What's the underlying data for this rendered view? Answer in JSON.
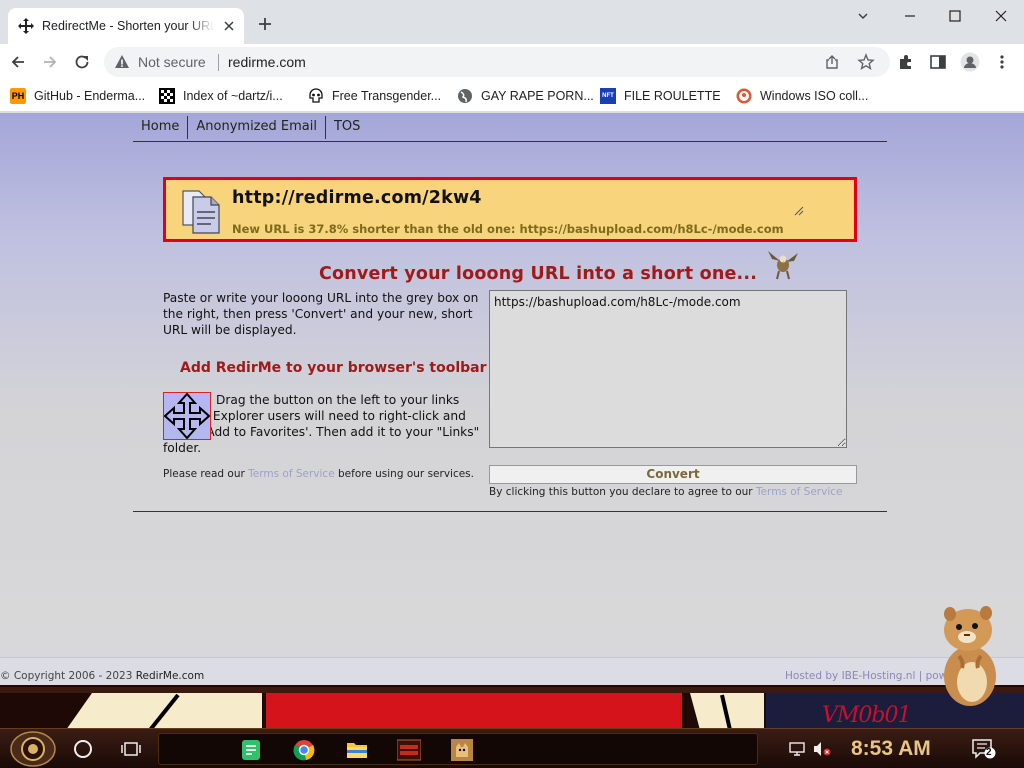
{
  "browser": {
    "tab_title": "RedirectMe - Shorten your URL",
    "security_label": "Not secure",
    "url": "redirme.com"
  },
  "bookmarks": [
    {
      "label": "GitHub - Enderma...",
      "icon": "ph-icon"
    },
    {
      "label": "Index of ~dartz/i...",
      "icon": "checker-icon"
    },
    {
      "label": "Free Transgender...",
      "icon": "skull-icon"
    },
    {
      "label": "GAY RAPE PORN...",
      "icon": "globe-icon"
    },
    {
      "label": "FILE ROULETTE",
      "icon": "nft-icon"
    },
    {
      "label": "Windows ISO coll...",
      "icon": "duckduckgo-icon"
    }
  ],
  "site": {
    "nav": [
      "Home",
      "Anonymized Email",
      "TOS"
    ],
    "short_url": "http://redirme.com/2kw4",
    "short_info": "New URL is 37.8% shorter than the old one: https://bashupload.com/h8Lc-/mode.com",
    "headline": "Convert your looong URL into a short one...",
    "intro": "Paste or write your looong URL into the grey box on the right, then press 'Convert' and your new, short URL will be displayed.",
    "toolbar_heading": "Add RedirMe to your browser's toolbar",
    "drag_text": "Drag the button on the left to your links toolbar. Explorer users will need to right-click and select 'Add to Favorites'. Then add it to your \"Links\" folder.",
    "tos_before": "Please read our ",
    "tos_link": "Terms of Service",
    "tos_after": " before using our services.",
    "input_value": "https://bashupload.com/h8Lc-/mode.com",
    "convert_label": "Convert",
    "agree_before": "By clicking this button you declare to agree to our ",
    "agree_link": "Terms of Service",
    "copyright_prefix": "© Copyright 2006 - 2023 ",
    "copyright_brand": "RedirMe.com",
    "hosted": "Hosted by IBE-Hosting.nl | pow... bear"
  },
  "taskbar": {
    "time": "8:53 AM",
    "notification_count": "2",
    "wallpaper_text": "VM0b01"
  },
  "colors": {
    "accent_red": "#a01a18",
    "result_bg": "#f8d57c",
    "result_border": "#e0001a"
  }
}
